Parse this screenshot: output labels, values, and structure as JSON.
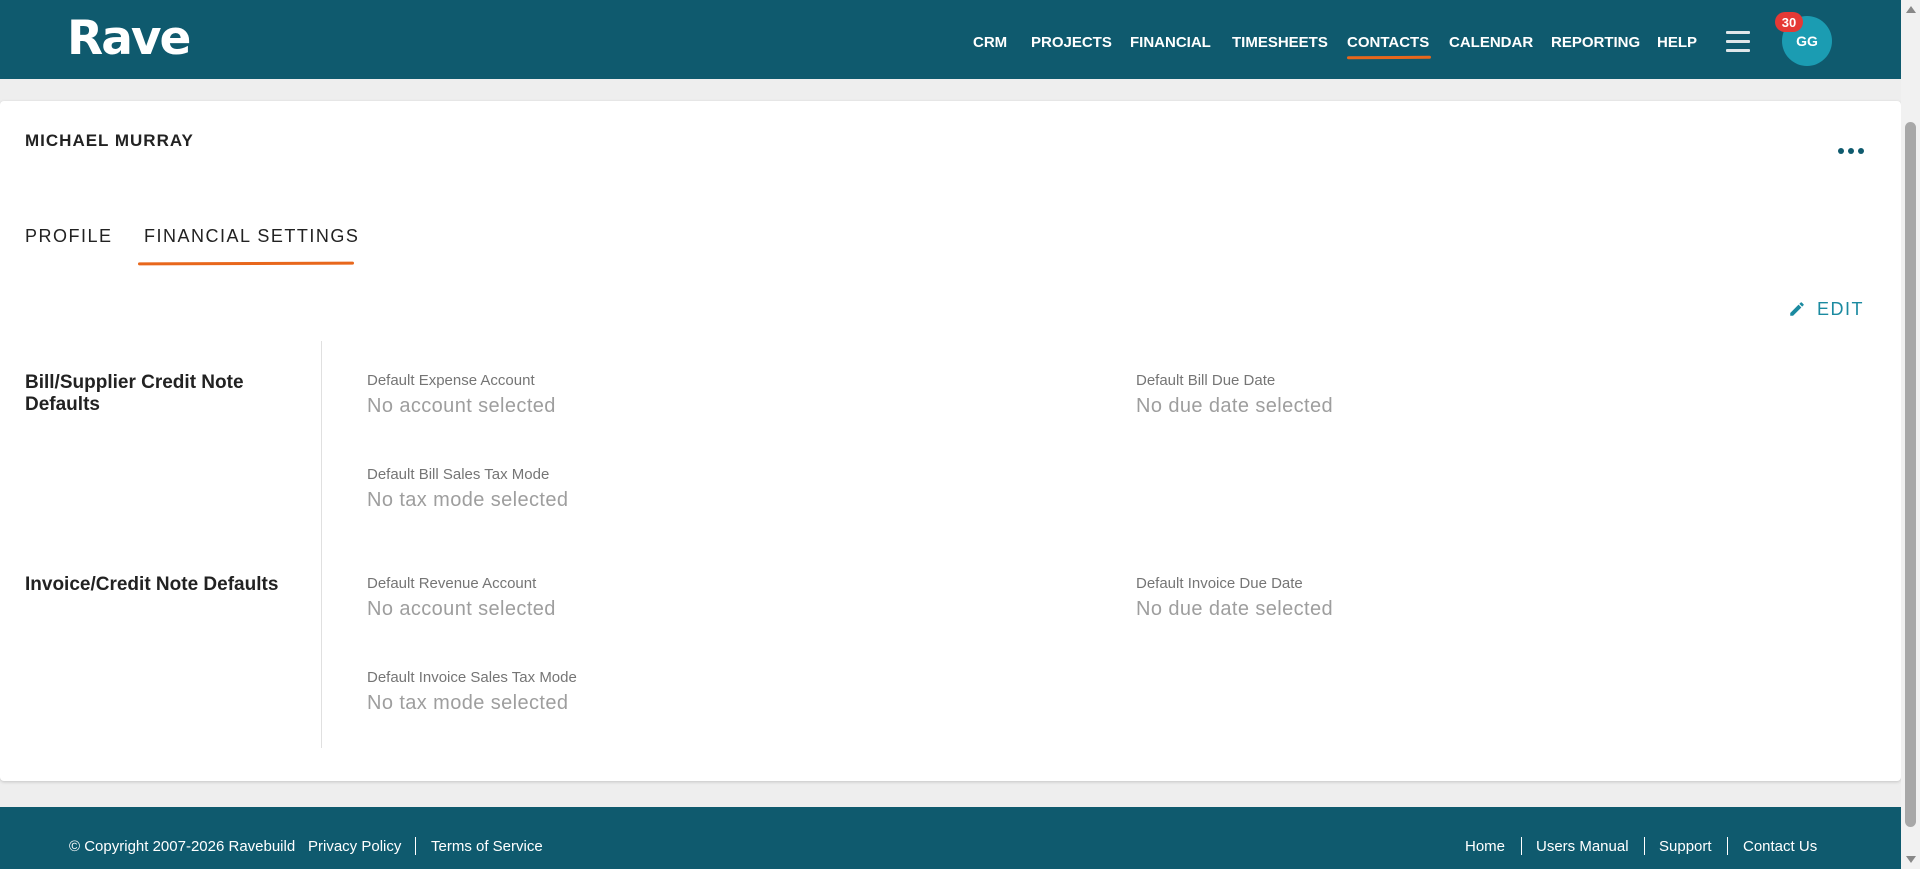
{
  "app": {
    "logo_text": "Rave"
  },
  "nav": {
    "items": [
      "CRM",
      "PROJECTS",
      "FINANCIAL",
      "TIMESHEETS",
      "CONTACTS",
      "CALENDAR",
      "REPORTING",
      "HELP"
    ],
    "active": "CONTACTS"
  },
  "user": {
    "initials": "GG",
    "notification_count": "30"
  },
  "contact": {
    "name": "MICHAEL MURRAY"
  },
  "tabs": [
    {
      "label": "PROFILE",
      "active": false
    },
    {
      "label": "FINANCIAL SETTINGS",
      "active": true
    }
  ],
  "actions": {
    "edit_label": "EDIT"
  },
  "sections": [
    {
      "title": "Bill/Supplier Credit Note Defaults",
      "fields": [
        {
          "label": "Default Expense Account",
          "value": "No account selected"
        },
        {
          "label": "Default Bill Due Date",
          "value": "No due date selected"
        },
        {
          "label": "Default Bill Sales Tax Mode",
          "value": "No tax mode selected"
        }
      ]
    },
    {
      "title": "Invoice/Credit Note Defaults",
      "fields": [
        {
          "label": "Default Revenue Account",
          "value": "No account selected"
        },
        {
          "label": "Default Invoice Due Date",
          "value": "No due date selected"
        },
        {
          "label": "Default Invoice Sales Tax Mode",
          "value": "No tax mode selected"
        }
      ]
    }
  ],
  "footer": {
    "copyright": "© Copyright 2007-2026 Ravebuild",
    "left_links": [
      "Privacy Policy",
      "Terms of Service"
    ],
    "right_links": [
      "Home",
      "Users Manual",
      "Support",
      "Contact Us"
    ]
  },
  "colors": {
    "header_bg": "#0f5a6e",
    "accent_orange": "#e8671c",
    "avatar_bg": "#1b9cb2",
    "badge_red": "#e53935",
    "edit_teal": "#1b8aa0"
  },
  "icons": [
    "hamburger-menu-icon",
    "more-options-icon",
    "pencil-icon"
  ]
}
